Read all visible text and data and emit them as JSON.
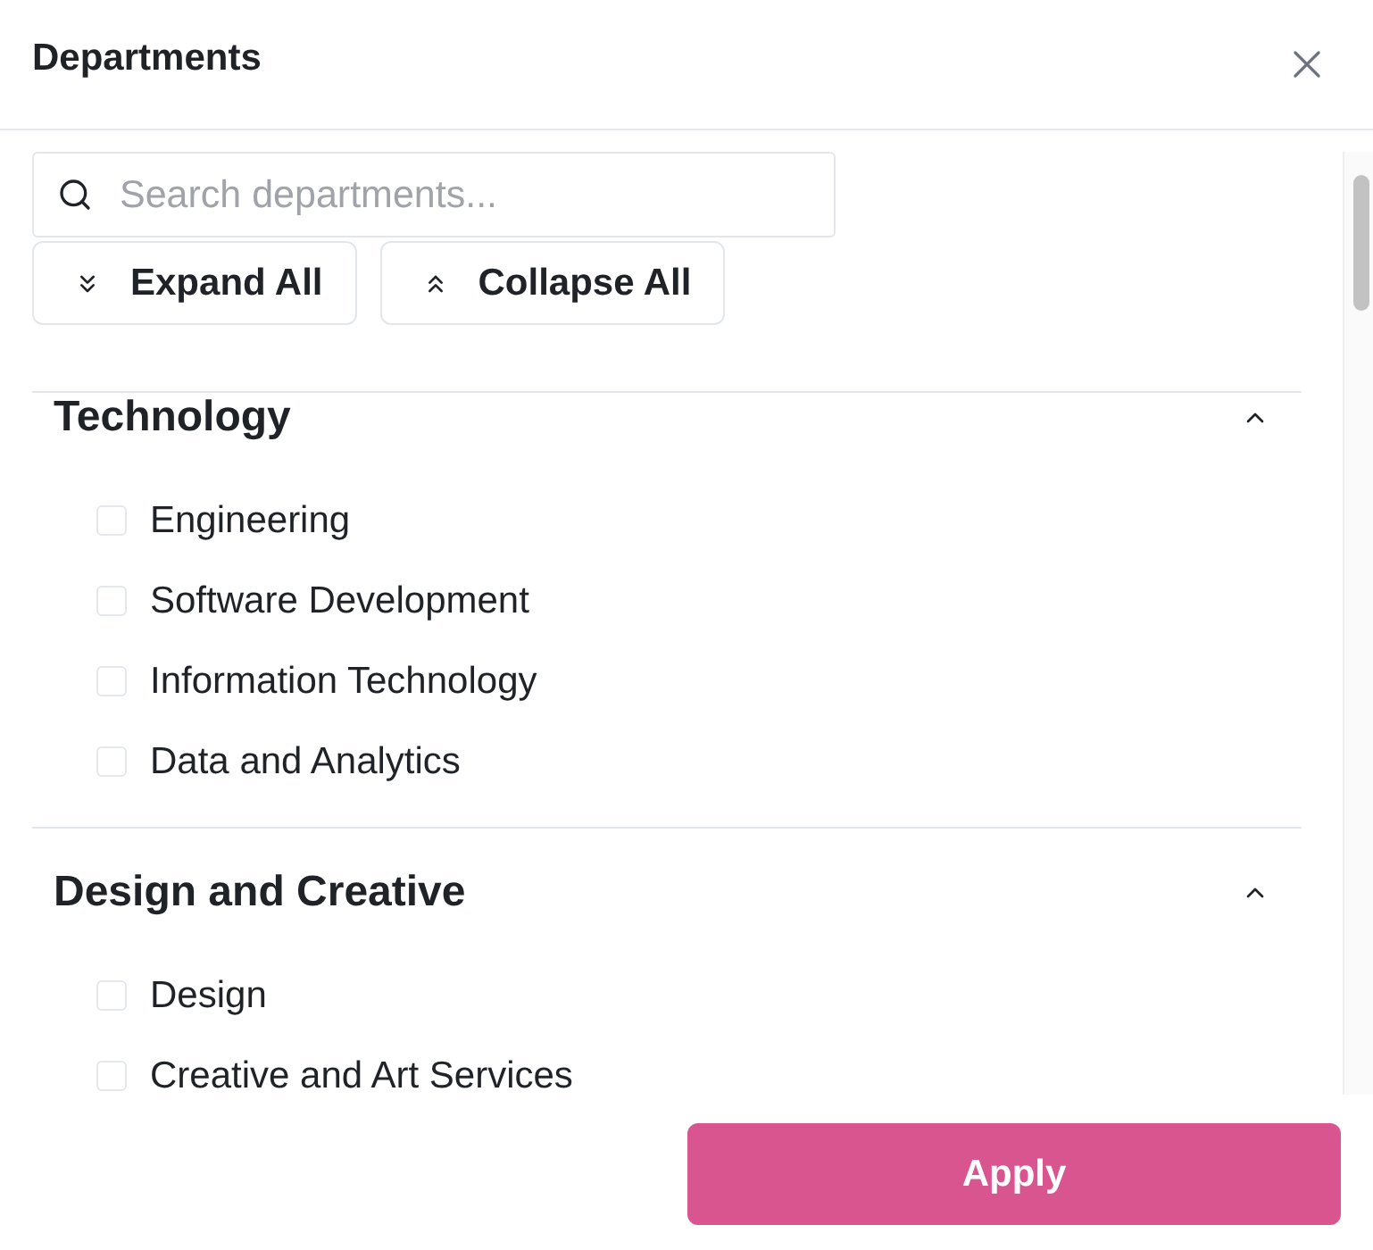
{
  "dialog": {
    "title": "Departments"
  },
  "search": {
    "placeholder": "Search departments..."
  },
  "actions": [
    {
      "label": "Expand All",
      "kind": "expand"
    },
    {
      "label": "Collapse All",
      "kind": "collapse"
    }
  ],
  "groups": [
    {
      "title": "Technology",
      "expanded": true,
      "items": [
        {
          "label": "Engineering",
          "checked": false
        },
        {
          "label": "Software Development",
          "checked": false
        },
        {
          "label": "Information Technology",
          "checked": false
        },
        {
          "label": "Data and Analytics",
          "checked": false
        }
      ]
    },
    {
      "title": "Design and Creative",
      "expanded": true,
      "items": [
        {
          "label": "Design",
          "checked": false
        },
        {
          "label": "Creative and Art Services",
          "checked": false
        }
      ]
    }
  ],
  "apply_button": {
    "label": "Apply"
  }
}
